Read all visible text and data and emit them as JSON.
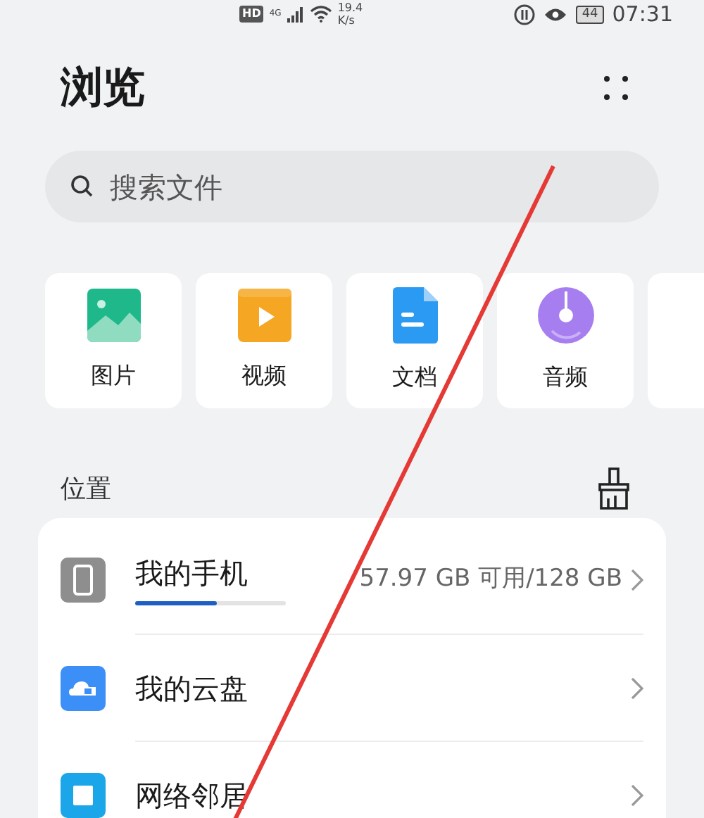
{
  "status_bar": {
    "hd": "HD",
    "network": "4G",
    "speed": "19.4",
    "speed_unit": "K/s",
    "battery": "44",
    "time": "07:31"
  },
  "header": {
    "title": "浏览"
  },
  "search": {
    "placeholder": "搜索文件"
  },
  "categories": [
    {
      "label": "图片",
      "kind": "image"
    },
    {
      "label": "视频",
      "kind": "video"
    },
    {
      "label": "文档",
      "kind": "document"
    },
    {
      "label": "音频",
      "kind": "audio"
    },
    {
      "kind": "blank"
    }
  ],
  "locations": {
    "title": "位置",
    "items": [
      {
        "label": "我的手机",
        "kind": "phone",
        "detail": "57.97 GB 可用/128 GB",
        "level": 0.54
      },
      {
        "label": "我的云盘",
        "kind": "cloud"
      },
      {
        "label": "网络邻居",
        "kind": "network"
      }
    ]
  }
}
